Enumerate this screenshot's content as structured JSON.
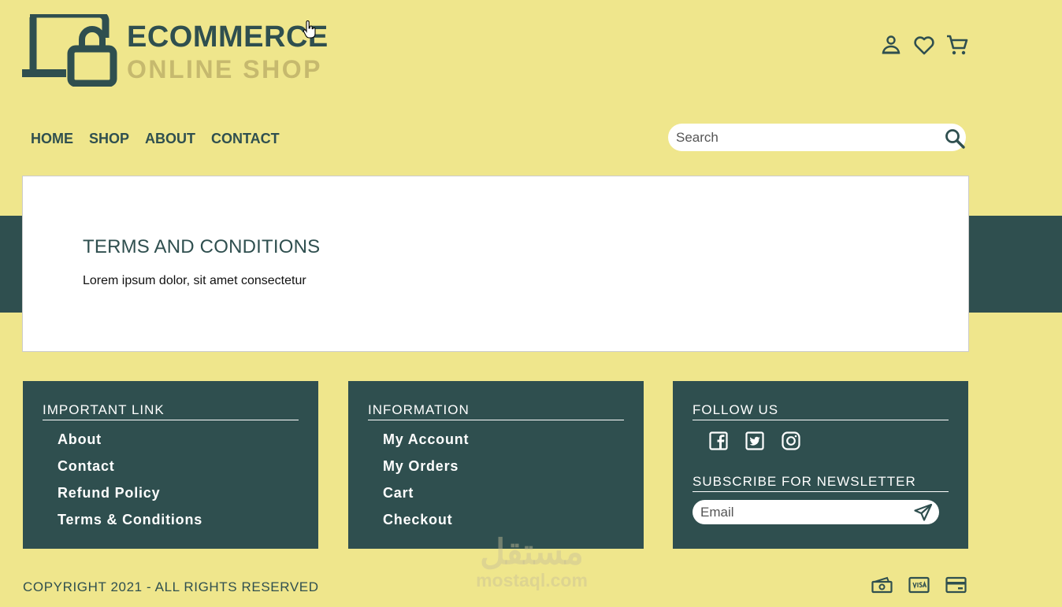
{
  "brand": {
    "line1": "ECOMMERCE",
    "line2": "ONLINE SHOP",
    "primary_color": "#2f4f4f",
    "secondary_color": "#c6b96e",
    "background_color": "#efe68c"
  },
  "header_icons": [
    "user-icon",
    "heart-icon",
    "cart-icon"
  ],
  "nav": {
    "items": [
      {
        "label": "HOME"
      },
      {
        "label": "SHOP"
      },
      {
        "label": "ABOUT"
      },
      {
        "label": "CONTACT"
      }
    ]
  },
  "search": {
    "placeholder": "Search"
  },
  "content": {
    "title": "TERMS AND CONDITIONS",
    "body": "Lorem ipsum dolor, sit amet consectetur"
  },
  "footer": {
    "important": {
      "title": "IMPORTANT LINK",
      "links": [
        "About",
        "Contact",
        "Refund Policy",
        "Terms & Conditions"
      ]
    },
    "information": {
      "title": "INFORMATION",
      "links": [
        "My Account",
        "My Orders",
        "Cart",
        "Checkout"
      ]
    },
    "follow": {
      "title": "FOLLOW US",
      "social": [
        "facebook-icon",
        "twitter-icon",
        "instagram-icon"
      ],
      "newsletter_title": "SUBSCRIBE FOR NEWSLETTER",
      "email_placeholder": "Email"
    },
    "copyright": "COPYRIGHT 2021 - ALL RIGHTS RESERVED",
    "payment_icons": [
      "cash-icon",
      "visa-icon",
      "credit-card-icon"
    ]
  },
  "watermark": {
    "arabic": "مستقل",
    "latin": "mostaql.com"
  }
}
